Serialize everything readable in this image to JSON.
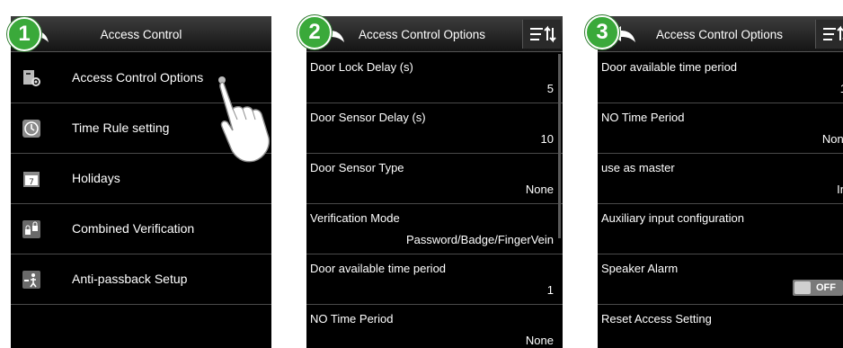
{
  "panel1": {
    "step": "1",
    "title": "Access Control",
    "items": [
      {
        "label": "Access Control Options",
        "icon": "access-options-icon"
      },
      {
        "label": "Time Rule setting",
        "icon": "clock-icon"
      },
      {
        "label": "Holidays",
        "icon": "calendar-icon"
      },
      {
        "label": "Combined Verification",
        "icon": "lock-group-icon"
      },
      {
        "label": "Anti-passback Setup",
        "icon": "anti-passback-icon"
      }
    ]
  },
  "panel2": {
    "step": "2",
    "title": "Access Control Options",
    "rows": [
      {
        "label": "Door Lock Delay (s)",
        "value": "5"
      },
      {
        "label": "Door Sensor Delay (s)",
        "value": "10"
      },
      {
        "label": "Door Sensor Type",
        "value": "None"
      },
      {
        "label": "Verification Mode",
        "value": "Password/Badge/FingerVein"
      },
      {
        "label": "Door available time period",
        "value": "1"
      },
      {
        "label": "NO Time Period",
        "value": "None"
      }
    ]
  },
  "panel3": {
    "step": "3",
    "title": "Access Control Options",
    "rows": [
      {
        "label": "Door available time period",
        "value": "1"
      },
      {
        "label": "NO Time Period",
        "value": "None"
      },
      {
        "label": "use as master",
        "value": "In"
      },
      {
        "label": "Auxiliary input configuration",
        "value": ""
      },
      {
        "label": "Speaker Alarm",
        "toggle": "OFF"
      },
      {
        "label": "Reset Access Setting",
        "value": ""
      }
    ]
  },
  "colors": {
    "badge": "#3aa93a",
    "screen": "#000000",
    "divider": "#4a4a4a"
  }
}
